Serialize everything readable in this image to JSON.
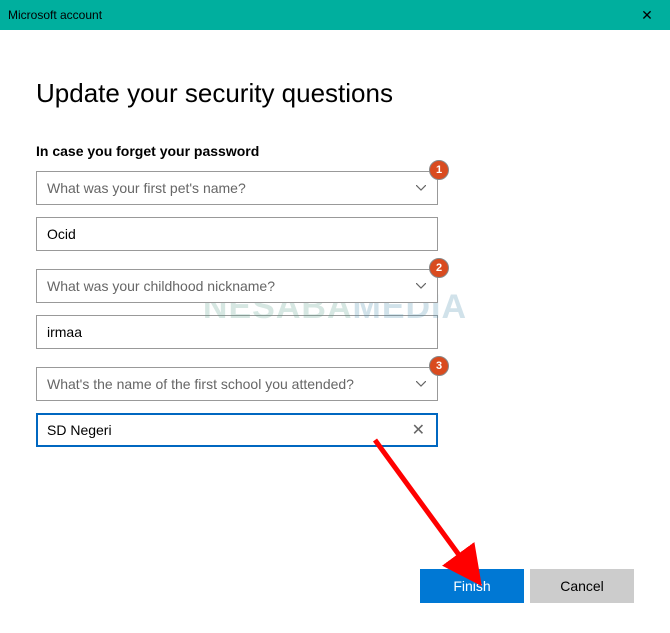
{
  "titlebar": {
    "title": "Microsoft account",
    "close_icon": "✕"
  },
  "page": {
    "title": "Update your security questions",
    "subtitle": "In case you forget your password"
  },
  "questions": [
    {
      "label": "What was your first pet's name?",
      "answer": "Ocid",
      "badge": "1"
    },
    {
      "label": "What was your childhood nickname?",
      "answer": "irmaa",
      "badge": "2"
    },
    {
      "label": "What's the name of the first school you attended?",
      "answer": "SD Negeri",
      "badge": "3"
    }
  ],
  "buttons": {
    "finish": "Finish",
    "cancel": "Cancel"
  },
  "watermark": {
    "a": "NESABA",
    "b": "MEDIA"
  },
  "clear_icon": "✕"
}
